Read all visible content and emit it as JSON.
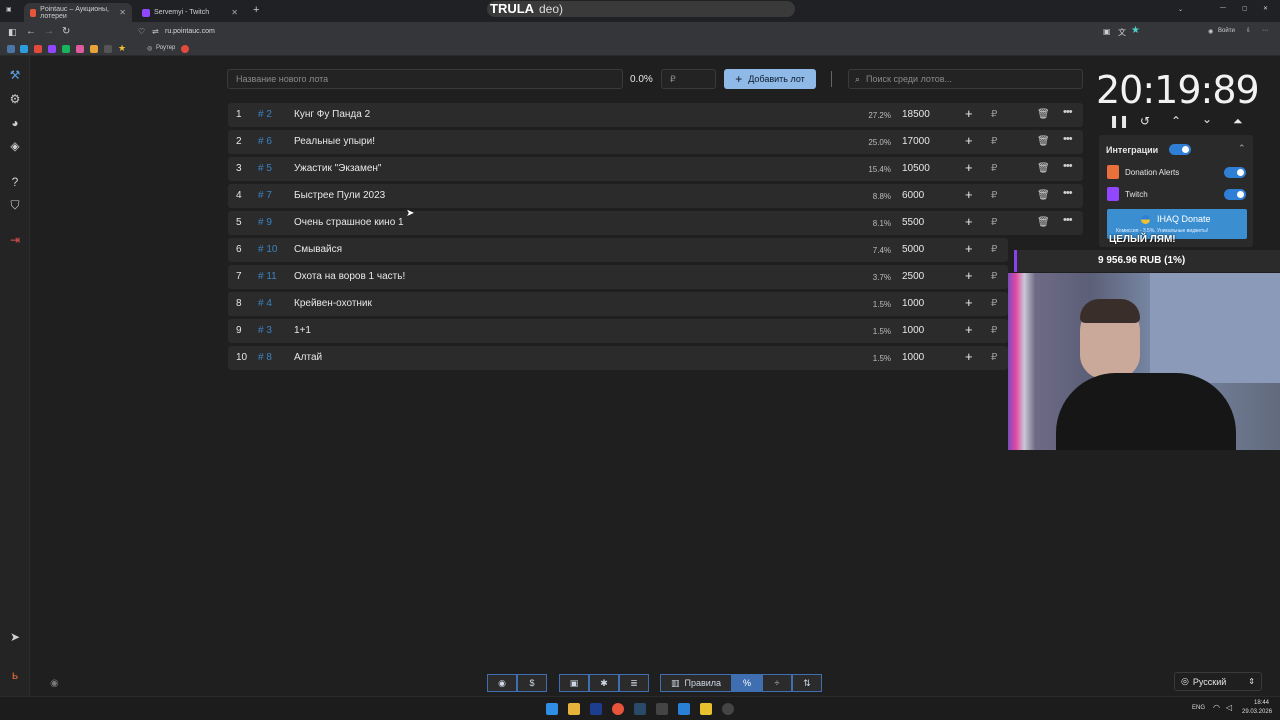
{
  "browser": {
    "tabs": [
      {
        "title": "Pointauc – Аукционы, лотереи",
        "active": true
      },
      {
        "title": "Servemyi - Twitch",
        "active": false
      }
    ],
    "new_tab_icon": "plus-icon",
    "url": "ru.pointauc.com",
    "overlay_text": "TRULA",
    "overlay_suffix": "deo)",
    "signin_label": "Войти",
    "bookmark_label": "Роутер"
  },
  "lot_form": {
    "name_placeholder": "Название нового лота",
    "percent": "0.0%",
    "amount_placeholder": "₽",
    "add_button_label": "Добавить лот",
    "search_placeholder": "Поиск среди лотов..."
  },
  "lots": [
    {
      "index": "1",
      "num": "# 2",
      "name": "Кунг Фу Панда 2",
      "pct": "27.2%",
      "amount": "18500"
    },
    {
      "index": "2",
      "num": "# 6",
      "name": "Реальные упыри!",
      "pct": "25.0%",
      "amount": "17000"
    },
    {
      "index": "3",
      "num": "# 5",
      "name": "Ужастик \"Экзамен\"",
      "pct": "15.4%",
      "amount": "10500"
    },
    {
      "index": "4",
      "num": "# 7",
      "name": "Быстрее Пули 2023",
      "pct": "8.8%",
      "amount": "6000"
    },
    {
      "index": "5",
      "num": "# 9",
      "name": "Очень страшное кино 1",
      "pct": "8.1%",
      "amount": "5500"
    },
    {
      "index": "6",
      "num": "# 10",
      "name": "Смывайся",
      "pct": "7.4%",
      "amount": "5000"
    },
    {
      "index": "7",
      "num": "# 11",
      "name": "Охота на воров 1 часть!",
      "pct": "3.7%",
      "amount": "2500"
    },
    {
      "index": "8",
      "num": "# 4",
      "name": "Крейвен-охотник",
      "pct": "1.5%",
      "amount": "1000"
    },
    {
      "index": "9",
      "num": "# 3",
      "name": "1+1",
      "pct": "1.5%",
      "amount": "1000"
    },
    {
      "index": "10",
      "num": "# 8",
      "name": "Алтай",
      "pct": "1.5%",
      "amount": "1000"
    }
  ],
  "currency_symbol": "₽",
  "timer": "20:19:89",
  "integrations": {
    "title": "Интеграции",
    "items": [
      {
        "label": "Donation Alerts",
        "enabled": true
      },
      {
        "label": "Twitch",
        "enabled": true
      }
    ],
    "donate_label": "IHAQ Donate",
    "donate_sub": "Комиссия - 3.5%. Уникальные виджеты!"
  },
  "overlay": {
    "goal_title": "ЦЕЛЫЙ ЛЯМ!",
    "goal_amount": "9 956.96 RUB (1%)"
  },
  "bottom": {
    "rules_label": "Правила",
    "language": "Русский"
  },
  "taskbar": {
    "lang": "ENG",
    "time": "18:44",
    "date": "29.03.2026"
  },
  "colors": {
    "accent": "#3b82c4",
    "add_button": "#8fb9e6",
    "toggle_on": "#2f7fd6"
  }
}
